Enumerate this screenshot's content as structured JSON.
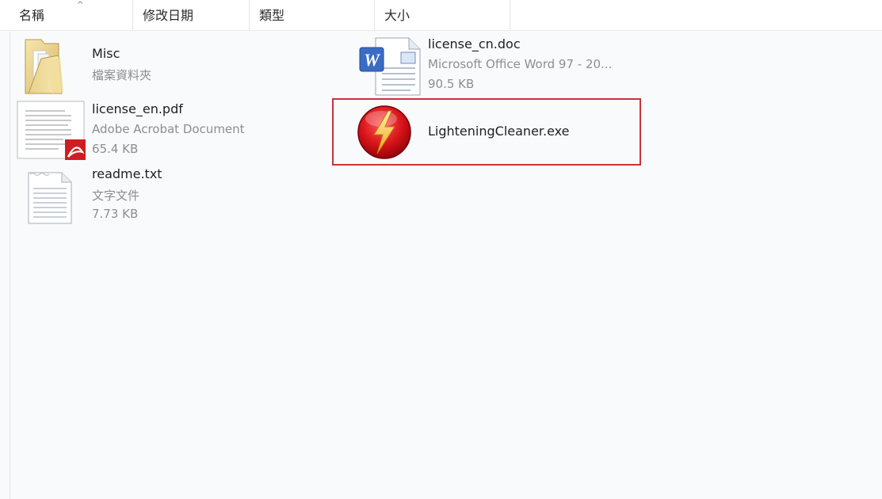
{
  "columns": {
    "name": "名稱",
    "date": "修改日期",
    "type": "類型",
    "size": "大小"
  },
  "sort_indicator": "^",
  "files": [
    {
      "name": "Misc",
      "type": "檔案資料夾",
      "icon": "folder-icon"
    },
    {
      "name": "license_cn.doc",
      "type": "Microsoft Office Word 97 - 20...",
      "size": "90.5 KB",
      "icon": "word-document-icon"
    },
    {
      "name": "license_en.pdf",
      "type": "Adobe Acrobat Document",
      "size": "65.4 KB",
      "icon": "pdf-document-icon"
    },
    {
      "name": "LighteningCleaner.exe",
      "icon": "lightning-app-icon",
      "highlighted": true
    },
    {
      "name": "readme.txt",
      "type": "文字文件",
      "size": "7.73 KB",
      "icon": "text-file-icon"
    }
  ],
  "colors": {
    "highlight_border": "#c6353b",
    "pane_background": "#f9fafc"
  }
}
